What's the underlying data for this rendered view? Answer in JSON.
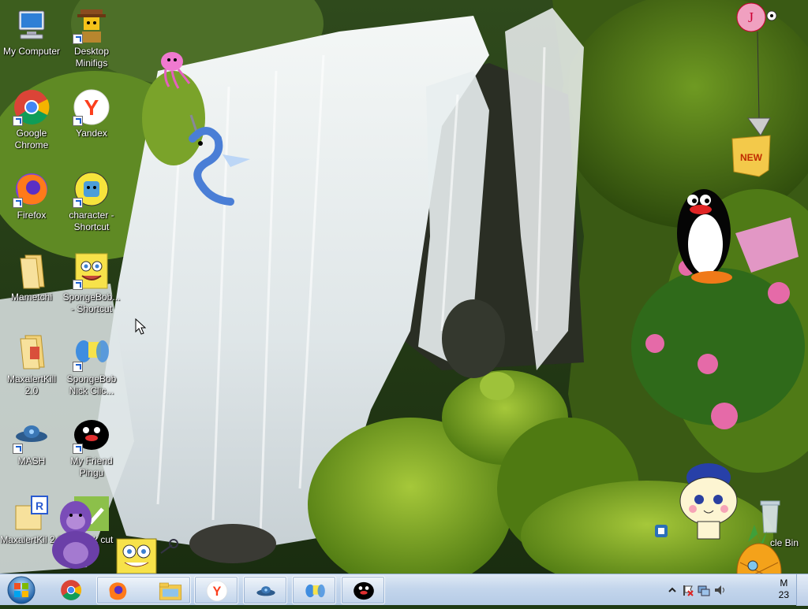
{
  "desktop": {
    "icons": [
      {
        "label": "My Computer"
      },
      {
        "label": "Desktop Minifigs"
      },
      {
        "label": "Google Chrome"
      },
      {
        "label": "Yandex"
      },
      {
        "label": "Firefox"
      },
      {
        "label": "character - Shortcut"
      },
      {
        "label": "Mametchi"
      },
      {
        "label": "SpongeBob... - Shortcut"
      },
      {
        "label": "MaxalertKill 2.0"
      },
      {
        "label": "SpongeBob Nick Clic..."
      },
      {
        "label": "MASH"
      },
      {
        "label": "My Friend Pingu"
      },
      {
        "label": "MaxalertKil 2.0"
      },
      {
        "label": "sk cut"
      },
      {
        "label": "cle Bin"
      }
    ],
    "toys": {
      "new_badge": "NEW"
    }
  },
  "taskbar": {
    "start_icon": "windows-start-orb",
    "buttons": [
      {
        "name": "chrome-icon"
      },
      {
        "name": "firefox-icon"
      },
      {
        "name": "file-explorer-icon"
      },
      {
        "name": "yandex-icon"
      },
      {
        "name": "mash-icon"
      },
      {
        "name": "spongebob-nick-icon"
      },
      {
        "name": "pingu-icon"
      }
    ],
    "clock": {
      "time": "M",
      "date": "23"
    },
    "colors": {
      "taskbar": "#c4d6ec",
      "accent": "#1a5fd0"
    }
  }
}
